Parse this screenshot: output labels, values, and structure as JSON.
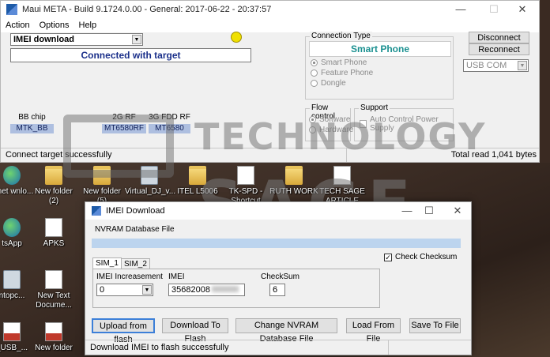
{
  "meta_window": {
    "title": "Maui META - Build 9.1724.0.00 - General: 2017-06-22 - 20:37:57",
    "menu": [
      "Action",
      "Options",
      "Help"
    ],
    "mode_select": "IMEI download",
    "connection_status": "Connected with target",
    "connection_type": {
      "legend": "Connection Type",
      "selected": "Smart Phone",
      "options": [
        "Smart Phone",
        "Feature Phone",
        "Dongle"
      ]
    },
    "disconnect_label": "Disconnect",
    "reconnect_label": "Reconnect",
    "port_select": "USB COM",
    "flow_control": {
      "legend": "Flow control",
      "options": [
        "Software",
        "Hardware"
      ]
    },
    "support": {
      "legend": "Support",
      "option": "Auto Control Power Supply"
    },
    "chips": [
      {
        "label": "BB chip",
        "value": "MTK_BB"
      },
      {
        "label": "2G RF",
        "value": "MT6580RF"
      },
      {
        "label": "3G FDD RF",
        "value": "MT6580"
      }
    ],
    "status_left": "Connect target successfully",
    "status_right": "Total read 1,041 bytes"
  },
  "watermark": {
    "line1": "TECHNOLOGY",
    "line2": "SAGE"
  },
  "desktop_icons": [
    {
      "label": "ernet wnlo...",
      "icon": "globe-icon"
    },
    {
      "label": "New folder (2)",
      "icon": "folder-icon"
    },
    {
      "label": "New folder (5)",
      "icon": "folder-icon"
    },
    {
      "label": "Virtual_DJ_v...",
      "icon": "pc-icon"
    },
    {
      "label": "ITEL L5006",
      "icon": "folder-icon"
    },
    {
      "label": "TK-SPD - Shortcut",
      "icon": "doc-icon"
    },
    {
      "label": "RUTH WORK",
      "icon": "folder-icon"
    },
    {
      "label": "TECH SAGE ARTICLE",
      "icon": "doc-icon"
    },
    {
      "label": "tsApp",
      "icon": "globe-icon"
    },
    {
      "label": "APKS",
      "icon": "doc-icon"
    },
    {
      "label": "ntopc...",
      "icon": "pc-icon"
    },
    {
      "label": "New Text Docume...",
      "icon": "doc-icon"
    },
    {
      "label": "_USB_...",
      "icon": "doc-icon"
    },
    {
      "label": "New folder",
      "icon": "folder-icon"
    }
  ],
  "imei_window": {
    "title": "IMEI Download",
    "nvram_label": "NVRAM Database File",
    "check_checksum_label": "Check Checksum",
    "tabs": [
      "SIM_1",
      "SIM_2"
    ],
    "imei_increasement_label": "IMEI Increasement",
    "imei_increasement_value": "0",
    "imei_label": "IMEI",
    "imei_value": "35682008",
    "checksum_label": "CheckSum",
    "checksum_value": "6",
    "buttons": {
      "upload": "Upload from flash",
      "download": "Download To Flash",
      "change_nvram": "Change NVRAM Database File",
      "load": "Load From File",
      "save": "Save To File"
    },
    "status": "Download IMEI to flash successfully"
  },
  "colors": {
    "accent": "#1a2f8a",
    "chip_bg": "#aebfe0",
    "connected_dot": "#f0e000",
    "nvram_bar": "#bcd4ee"
  }
}
